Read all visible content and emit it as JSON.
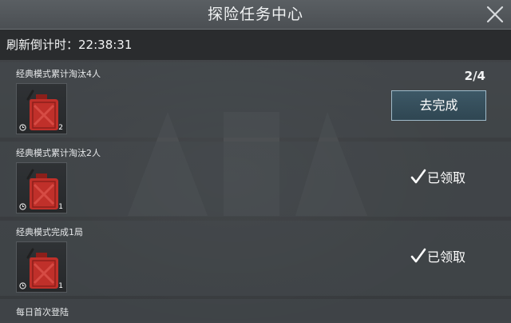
{
  "header": {
    "title": "探险任务中心",
    "close_icon": "close-icon"
  },
  "refresh": {
    "label": "刷新倒计时：",
    "time": "22:38:31"
  },
  "tasks": [
    {
      "name": "经典模式累计淘汰4人",
      "progress": "2/4",
      "reward_icon": "fuel-can-icon",
      "reward_count": "2",
      "action": "去完成",
      "status": "incomplete"
    },
    {
      "name": "经典模式累计淘汰2人",
      "reward_icon": "fuel-can-icon",
      "reward_count": "1",
      "status_text": "已领取",
      "status": "claimed"
    },
    {
      "name": "经典模式完成1局",
      "reward_icon": "fuel-can-icon",
      "reward_count": "1",
      "status_text": "已领取",
      "status": "claimed"
    },
    {
      "name": "每日首次登陆"
    }
  ],
  "colors": {
    "button_bg": "#355060",
    "button_border": "#9eb9c8",
    "fuel_can": "#c0302a"
  }
}
